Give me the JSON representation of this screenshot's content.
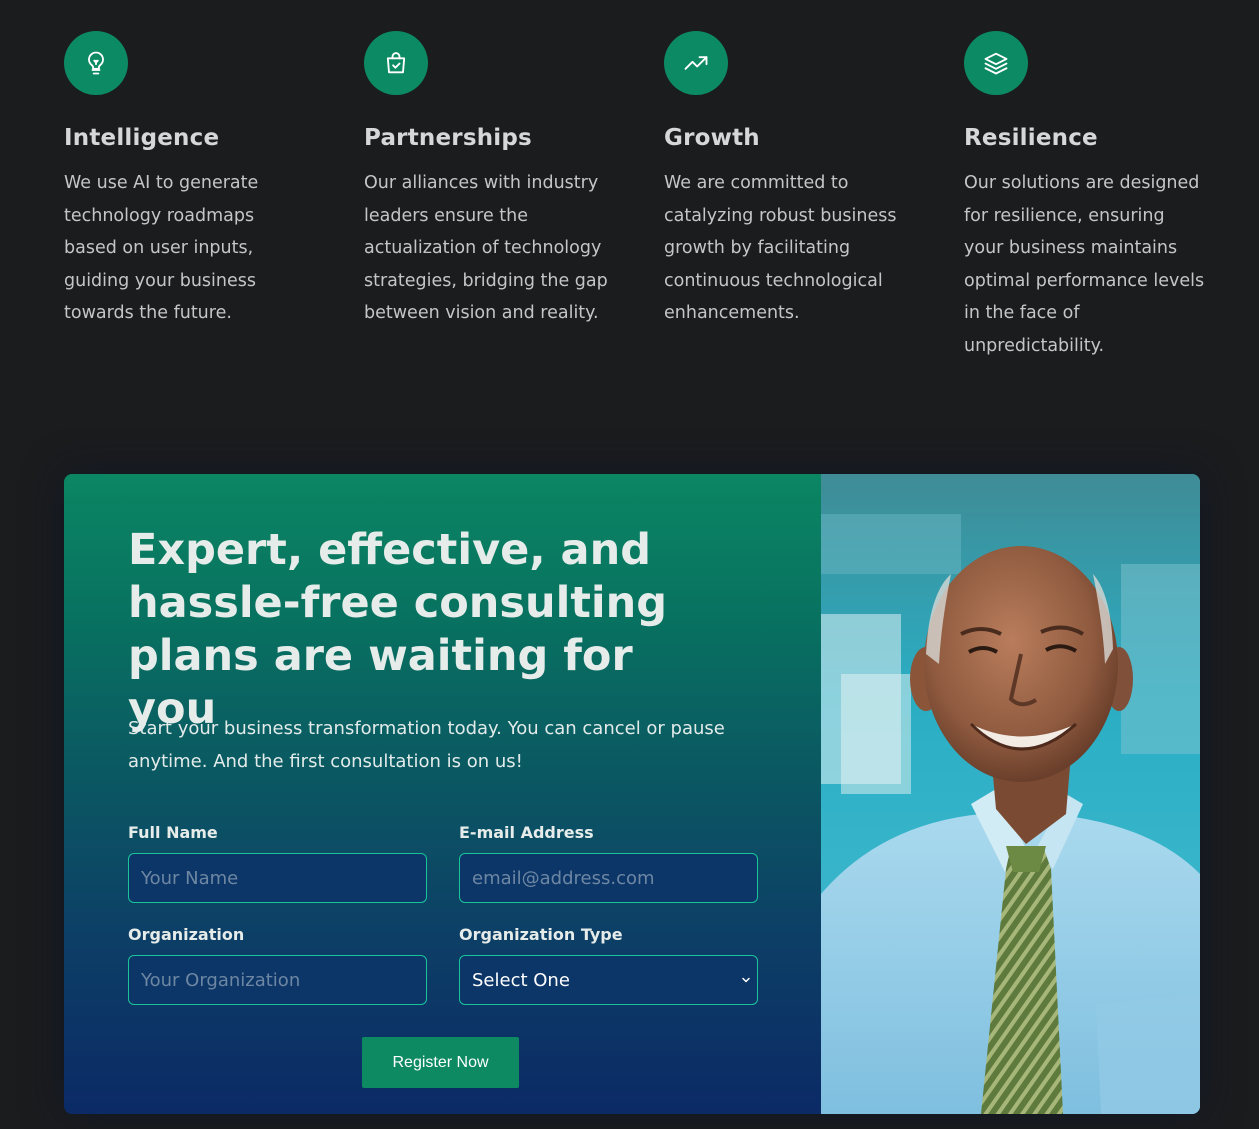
{
  "features": [
    {
      "icon": "lightbulb-icon",
      "title": "Intelligence",
      "text": "We use AI to generate technology roadmaps based on user inputs, guiding your business towards the future."
    },
    {
      "icon": "shopping-bag-check-icon",
      "title": "Partnerships",
      "text": "Our alliances with industry leaders ensure the actualization of technology strategies, bridging the gap between vision and reality."
    },
    {
      "icon": "trending-up-icon",
      "title": "Growth",
      "text": "We are committed to catalyzing robust business growth by facilitating continuous technological enhancements."
    },
    {
      "icon": "layers-icon",
      "title": "Resilience",
      "text": "Our solutions are designed for resilience, ensuring your business maintains optimal performance levels in the face of unpredictability."
    }
  ],
  "cta": {
    "heading": "Expert, effective, and hassle-free consulting plans are waiting for you",
    "subtext": "Start your business transformation today. You can cancel or pause anytime. And the first consultation is on us!",
    "form": {
      "full_name_label": "Full Name",
      "full_name_placeholder": "Your Name",
      "full_name_value": "",
      "email_label": "E-mail Address",
      "email_placeholder": "email@address.com",
      "email_value": "",
      "organization_label": "Organization",
      "organization_placeholder": "Your Organization",
      "organization_value": "",
      "org_type_label": "Organization Type",
      "org_type_selected": "Select One",
      "submit_label": "Register Now"
    }
  },
  "colors": {
    "page_background": "#1b1c1e",
    "accent_green": "#0c8a63",
    "field_border": "#19c49a",
    "field_background": "#0d3668"
  }
}
